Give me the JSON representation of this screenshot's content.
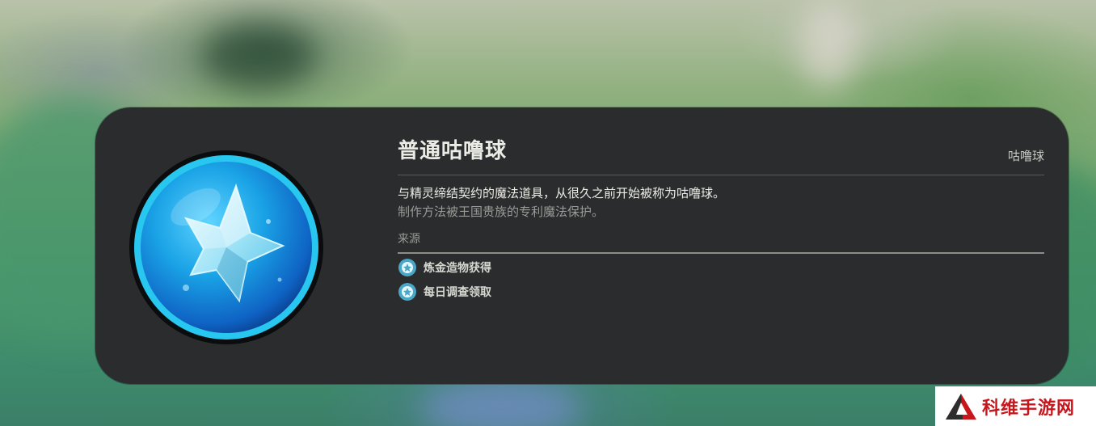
{
  "item": {
    "name": "普通咕噜球",
    "category": "咕噜球",
    "description": "与精灵缔结契约的魔法道具，从很久之前开始被称为咕噜球。",
    "flavor": "制作方法被王国贵族的专利魔法保护。",
    "source_label": "来源",
    "sources": [
      {
        "label": "炼金造物获得",
        "icon": "source-badge-icon"
      },
      {
        "label": "每日调查领取",
        "icon": "source-badge-icon"
      }
    ],
    "icon": "blue-crystal-orb-icon"
  },
  "watermark": {
    "text": "科维手游网",
    "logo": "red-triangle-logo"
  },
  "colors": {
    "panel": "#2b2c2e",
    "title": "#ecece6",
    "muted": "#9a9b97",
    "source_icon": "#49a7c8",
    "orb_blue": "#1aa3e6",
    "watermark_red": "#c8161d"
  }
}
